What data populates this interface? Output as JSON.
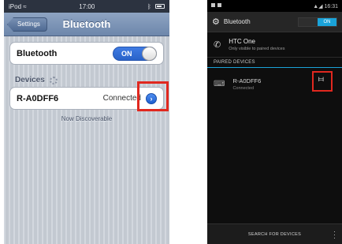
{
  "ios": {
    "status": {
      "carrier": "iPod",
      "time": "17:00"
    },
    "nav": {
      "back_label": "Settings",
      "title": "Bluetooth"
    },
    "bluetooth_row": {
      "label": "Bluetooth",
      "toggle_label": "ON"
    },
    "devices_section": {
      "label": "Devices"
    },
    "device": {
      "name": "R-A0DFF6",
      "status": "Connected"
    },
    "hint": "Now Discoverable"
  },
  "android": {
    "status": {
      "time": "16:31"
    },
    "action_bar": {
      "title": "Bluetooth",
      "switch_label": "ON"
    },
    "own_device": {
      "name": "HTC One",
      "subtitle": "Only visible to paired devices"
    },
    "paired_header": "PAIRED DEVICES",
    "paired_device": {
      "name": "R-A0DFF6",
      "status": "Connected"
    },
    "bottom": {
      "search_label": "SEARCH FOR DEVICES"
    }
  },
  "colors": {
    "highlight": "#e0281f",
    "ios_accent": "#3f7be3",
    "android_accent": "#1aa3d9"
  },
  "icons": [
    "wifi-icon",
    "bluetooth-icon",
    "battery-icon",
    "back-arrow-icon",
    "spinner-icon",
    "disclosure-arrow-icon",
    "gear-icon",
    "phone-icon",
    "keyboard-icon",
    "settings-sliders-icon",
    "overflow-menu-icon"
  ]
}
